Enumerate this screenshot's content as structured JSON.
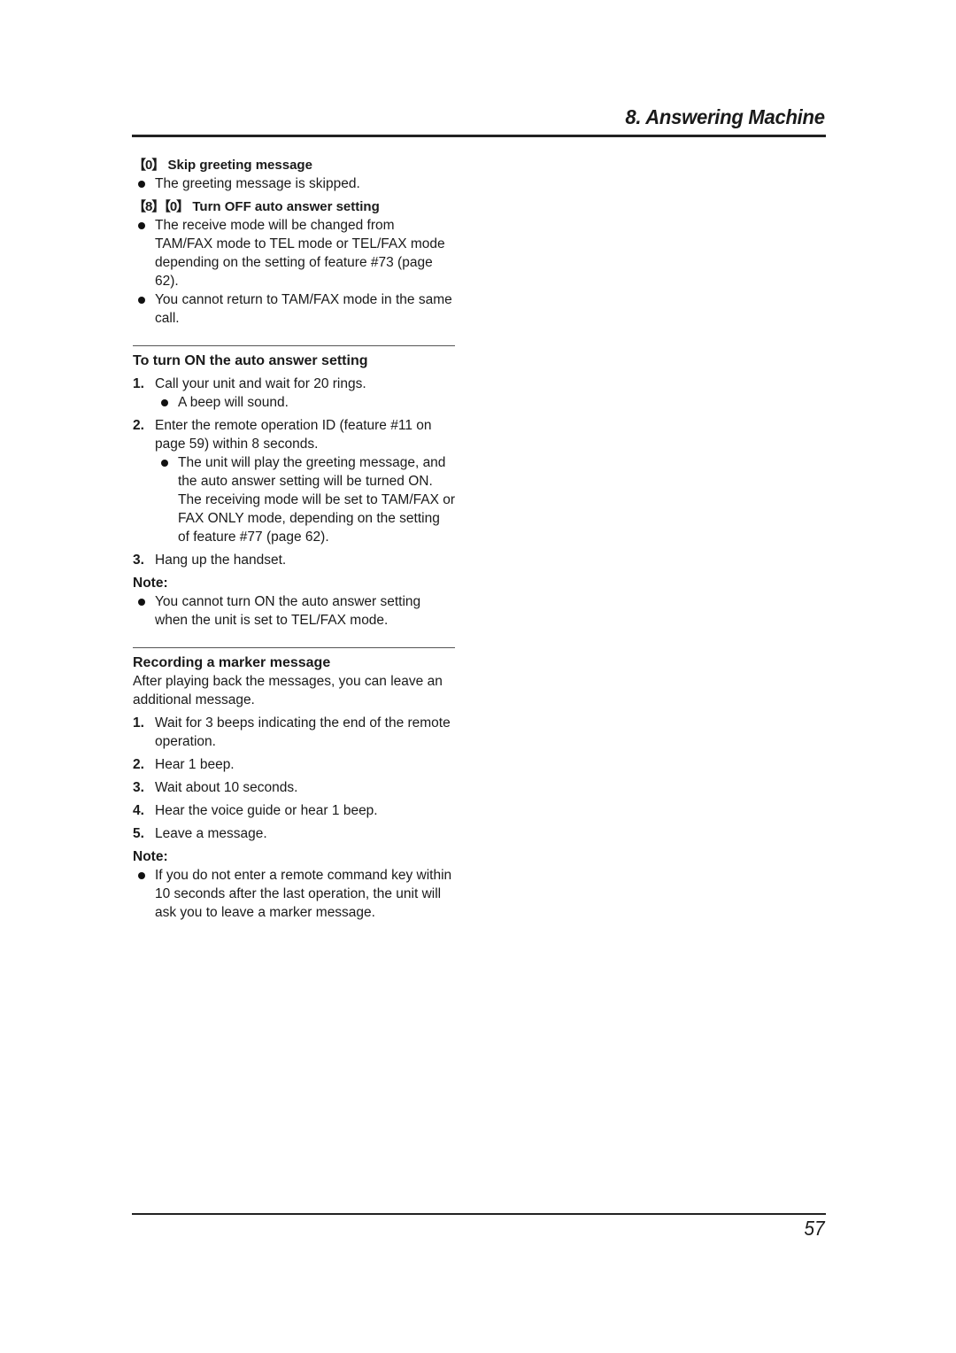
{
  "header": {
    "chapter_title": "8. Answering Machine"
  },
  "commands": [
    {
      "keys": "【0】",
      "title": "Skip greeting message",
      "bullets": [
        "The greeting message is skipped."
      ]
    },
    {
      "keys": "【8】【0】",
      "title": "Turn OFF auto answer setting",
      "bullets": [
        "The receive mode will be changed from TAM/FAX mode to TEL mode or TEL/FAX mode depending on the setting of feature #73 (page 62).",
        "You cannot return to TAM/FAX mode in the same call."
      ]
    }
  ],
  "section_turn_on": {
    "title": "To turn ON the auto answer setting",
    "steps": [
      {
        "num": "1.",
        "text": "Call your unit and wait for 20 rings.",
        "sub": [
          "A beep will sound."
        ]
      },
      {
        "num": "2.",
        "text": "Enter the remote operation ID (feature #11 on page 59) within 8 seconds.",
        "sub": [
          "The unit will play the greeting message, and the auto answer setting will be turned ON. The receiving mode will be set to TAM/FAX or FAX ONLY mode, depending on the setting of feature #77 (page 62)."
        ]
      },
      {
        "num": "3.",
        "text": "Hang up the handset.",
        "sub": []
      }
    ],
    "note_label": "Note:",
    "notes": [
      "You cannot turn ON the auto answer setting when the unit is set to TEL/FAX mode."
    ]
  },
  "section_marker": {
    "title": "Recording a marker message",
    "intro": "After playing back the messages, you can leave an additional message.",
    "steps": [
      {
        "num": "1.",
        "text": "Wait for 3 beeps indicating the end of the remote operation."
      },
      {
        "num": "2.",
        "text": "Hear 1 beep."
      },
      {
        "num": "3.",
        "text": "Wait about 10 seconds."
      },
      {
        "num": "4.",
        "text": "Hear the voice guide or hear 1 beep."
      },
      {
        "num": "5.",
        "text": "Leave a message."
      }
    ],
    "note_label": "Note:",
    "notes": [
      "If you do not enter a remote command key within 10 seconds after the last operation, the unit will ask you to leave a marker message."
    ]
  },
  "footer": {
    "page_number": "57"
  }
}
